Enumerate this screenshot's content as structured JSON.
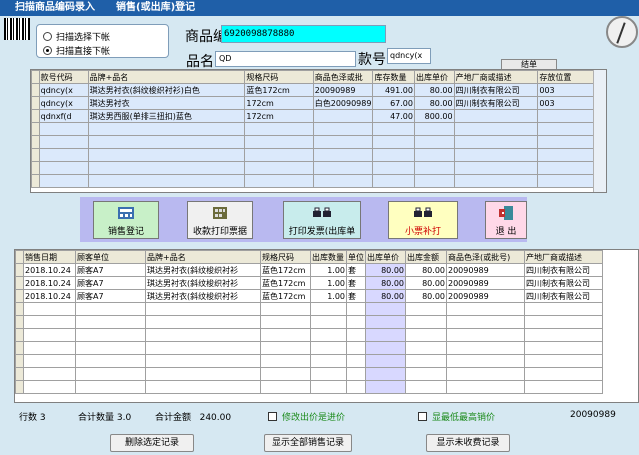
{
  "title": {
    "left": "扫描商品编码录入",
    "right": "销售(或出库)登记"
  },
  "scan_mode": {
    "opt1": "扫描选择下帐",
    "opt2": "扫描直接下帐",
    "selected": 2
  },
  "form": {
    "code_label": "商品编码",
    "code_value": "6920098878880",
    "name_label": "品名",
    "name_value": "QD",
    "kuan_label": "款号代码",
    "kuan_value": "qdncy(x",
    "small_btn": "结单"
  },
  "stock_table": {
    "headers": [
      "款号代码",
      "品牌+品名",
      "规格尺码",
      "商品色泽或批",
      "库存数量",
      "出库单价",
      "产地厂商或描述",
      "存放位置"
    ],
    "rows": [
      [
        "qdncy(x",
        "琪达男衬衣(斜纹梭织衬衫)白色",
        "蓝色172cm",
        "20090989",
        "491.00",
        "80.00",
        "四川制衣有限公司",
        "003"
      ],
      [
        "qdncy(x",
        "琪达男衬衣",
        "172cm",
        "白色20090989",
        "67.00",
        "80.00",
        "四川制衣有限公司",
        "003"
      ],
      [
        "qdnxf(d",
        "琪达男西服(单排三扭扣)蓝色",
        "172cm",
        "",
        "47.00",
        "800.00",
        "",
        ""
      ]
    ]
  },
  "toolbar": {
    "b1": "销售登记",
    "b2": "收款打印票据",
    "b3": "打印发票(出库单",
    "b4": "小票补打",
    "b5": "退 出"
  },
  "sales_table": {
    "headers": [
      "销售日期",
      "顾客单位",
      "品牌+品名",
      "规格尺码",
      "出库数量",
      "单位",
      "出库单价",
      "出库金额",
      "商品色泽(或批号)",
      "产地厂商或描述"
    ],
    "rows": [
      [
        "2018.10.24",
        "顾客A7",
        "琪达男衬衣(斜纹梭织衬衫",
        "蓝色172cm",
        "1.00",
        "套",
        "80.00",
        "80.00",
        "20090989",
        "四川制衣有限公司"
      ],
      [
        "2018.10.24",
        "顾客A7",
        "琪达男衬衣(斜纹梭织衬衫",
        "蓝色172cm",
        "1.00",
        "套",
        "80.00",
        "80.00",
        "20090989",
        "四川制衣有限公司"
      ],
      [
        "2018.10.24",
        "顾客A7",
        "琪达男衬衣(斜纹梭织衬衫",
        "蓝色172cm",
        "1.00",
        "套",
        "80.00",
        "80.00",
        "20090989",
        "四川制衣有限公司"
      ]
    ]
  },
  "status": {
    "rows_label": "行数",
    "rows_value": "3",
    "qty_label": "合计数量",
    "qty_value": "3.0",
    "amt_label": "合计金额",
    "amt_value": "240.00",
    "chk1": "修改出价是进价",
    "chk2": "显最低最高销价",
    "batch": "20090989"
  },
  "bottom": {
    "b1": "删除选定记录",
    "b2": "显示全部销售记录",
    "b3": "显示未收费记录"
  },
  "colors": {
    "title_bg": "#1f5fa8",
    "code_bg": "#00ffff",
    "chk_green": "#1a8a1a"
  }
}
